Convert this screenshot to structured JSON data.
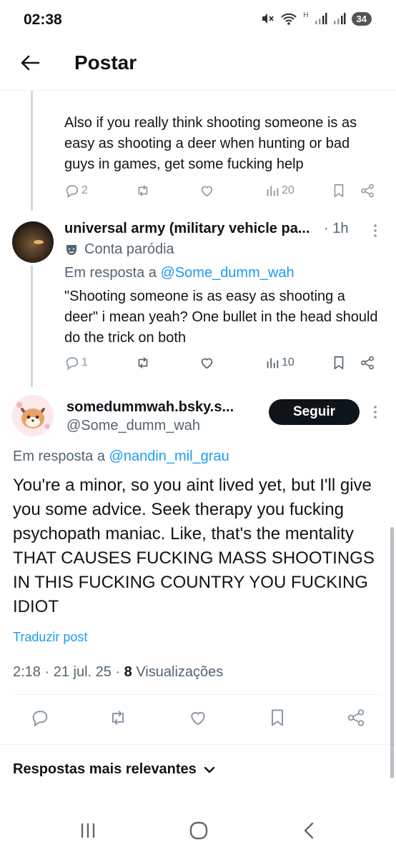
{
  "status": {
    "time": "02:38",
    "signal_label": "H",
    "battery": "34"
  },
  "header": {
    "title": "Postar"
  },
  "prev_tweet": {
    "text": "Also if you really think shooting someone is as easy as shooting a deer when hunting or bad guys in games, get some fucking help",
    "replies": "2",
    "views": "20"
  },
  "reply_tweet": {
    "name": "universal army (military vehicle pa...",
    "time": "· 1h",
    "parody_label": "Conta paródia",
    "reply_prefix": "Em resposta a",
    "reply_to": "@Some_dumm_wah",
    "text": "\"Shooting someone is as easy as shooting a deer\" i mean yeah? One bullet in the head should do the trick on both",
    "replies": "1",
    "views": "10"
  },
  "main_tweet": {
    "name": "somedummwah.bsky.s...",
    "handle": "@Some_dumm_wah",
    "follow_label": "Seguir",
    "reply_prefix": "Em resposta a",
    "reply_to": "@nandin_mil_grau",
    "text": "You're a minor, so you aint lived yet, but I'll give you some advice. Seek therapy you fucking psychopath maniac. Like, that's the mentality THAT CAUSES FUCKING MASS SHOOTINGS IN THIS FUCKING COUNTRY YOU FUCKING IDIOT",
    "translate_label": "Traduzir post",
    "date": "2:18 · 21 jul. 25 ·",
    "views_count": "8",
    "views_label": "Visualizações"
  },
  "replies_sort": {
    "label": "Respostas mais relevantes"
  },
  "colors": {
    "accent": "#1d9bf0",
    "text": "#0f1419",
    "muted": "#536471",
    "icon": "#8b98a5"
  }
}
